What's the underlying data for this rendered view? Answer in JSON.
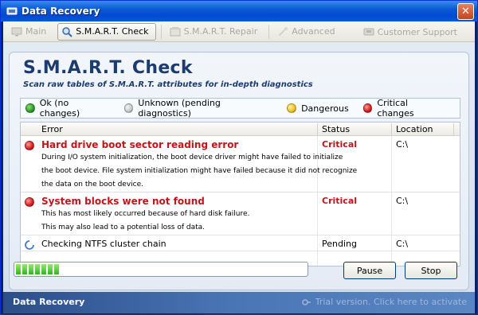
{
  "window": {
    "title": "Data Recovery",
    "close_glyph": "✕"
  },
  "toolbar": {
    "main": "Main",
    "smart_check": "S.M.A.R.T. Check",
    "smart_repair": "S.M.A.R.T. Repair",
    "advanced": "Advanced",
    "support": "Customer Support"
  },
  "page": {
    "title": "S.M.A.R.T. Check",
    "subtitle": "Scan raw tables of S.M.A.R.T. attributes for in-depth diagnostics"
  },
  "legend": [
    {
      "label": "Ok (no changes)",
      "color": "#2e9a2a"
    },
    {
      "label": "Unknown (pending diagnostics)",
      "color": "#c8c8c8"
    },
    {
      "label": "Dangerous",
      "color": "#f0c020"
    },
    {
      "label": "Critical changes",
      "color": "#d42020"
    }
  ],
  "table": {
    "headers": {
      "error": "Error",
      "status": "Status",
      "location": "Location"
    },
    "rows": [
      {
        "title": "Hard drive boot sector reading error",
        "desc": [
          "During I/O system initialization, the boot device driver might have failed to initialize",
          "the boot device. File system initialization might have failed because it did not recognize",
          "the data on the boot device."
        ],
        "status": "Critical",
        "location": "C:\\"
      },
      {
        "title": "System blocks were not found",
        "desc": [
          "This has most likely occurred because of hard disk failure.",
          "This may also lead to a potential loss of data."
        ],
        "status": "Critical",
        "location": "C:\\"
      },
      {
        "title": "Checking NTFS cluster chain",
        "desc": [],
        "status": "Pending",
        "location": "C:\\"
      }
    ]
  },
  "progress": {
    "fraction": 0.15
  },
  "buttons": {
    "pause": "Pause",
    "stop": "Stop"
  },
  "statusbar": {
    "left": "Data Recovery",
    "right": "Trial version. Click here to activate"
  },
  "colors": {
    "critical": "#c0161b",
    "accent": "#1c3b6e"
  }
}
